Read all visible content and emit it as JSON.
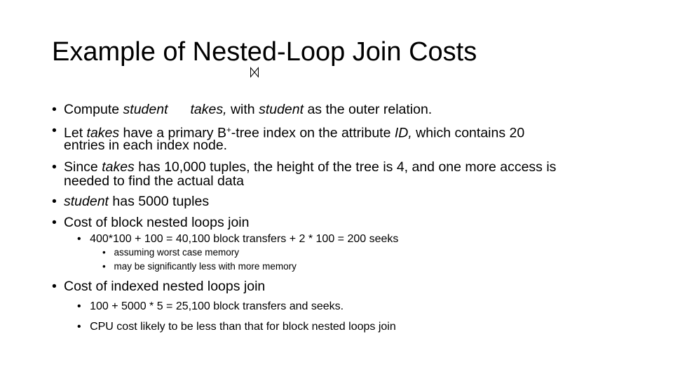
{
  "slide": {
    "title": "Example of Nested-Loop Join Costs",
    "join_symbol": "⋈",
    "bullets": [
      {
        "id": "b1",
        "parts": [
          {
            "text": "Compute ",
            "italic": false
          },
          {
            "text": "student",
            "italic": true
          },
          {
            "text": "     ",
            "italic": false
          },
          {
            "text": "takes,",
            "italic": true
          },
          {
            "text": " with ",
            "italic": false
          },
          {
            "text": "student",
            "italic": true
          },
          {
            "text": " as the outer relation.",
            "italic": false
          }
        ]
      },
      {
        "id": "b2",
        "line1": [
          {
            "text": "Let ",
            "italic": false
          },
          {
            "text": "takes",
            "italic": true
          },
          {
            "text": " have a primary B",
            "italic": false
          },
          {
            "text": "+",
            "sup": true
          },
          {
            "text": "-tree index on the attribute ",
            "italic": false
          },
          {
            "text": "ID,",
            "italic": true
          },
          {
            "text": " which contains 20",
            "italic": false
          }
        ],
        "line2": "entries in each index node."
      },
      {
        "id": "b3",
        "line1": [
          {
            "text": "Since ",
            "italic": false
          },
          {
            "text": "takes",
            "italic": true
          },
          {
            "text": " has 10,000 tuples, the height of the tree is 4, and one more access is",
            "italic": false
          }
        ],
        "line2": "needed to find the actual data"
      },
      {
        "id": "b4",
        "parts": [
          {
            "text": "student",
            "italic": true
          },
          {
            "text": " has 5000 tuples",
            "italic": false
          }
        ]
      },
      {
        "id": "b5",
        "text": "Cost of block nested loops join",
        "sub": {
          "text": "400*100 + 100 =  40,100 block transfers + 2 * 100 = 200 seeks",
          "subsub": [
            " assuming worst case memory",
            "may be significantly less with more memory"
          ]
        }
      },
      {
        "id": "b6",
        "text": " Cost of indexed nested loops join",
        "subs": [
          "100 + 5000 * 5 = 25,100  block transfers and seeks.",
          "CPU cost likely to be less than that for block nested loops join"
        ]
      }
    ],
    "bullet_char": "•"
  }
}
